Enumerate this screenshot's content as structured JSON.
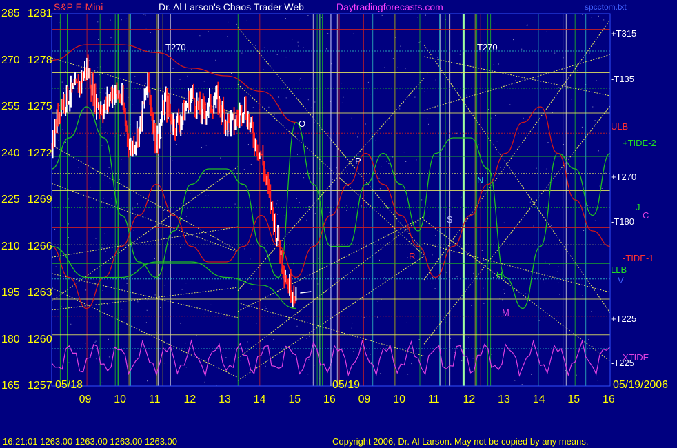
{
  "header": {
    "instrument": "S&P E-Mini",
    "title": "Dr. Al Larson's Chaos Trader Web",
    "site": "Daytradingforecasts.com",
    "filename": "spcctom.txt"
  },
  "footer": {
    "status": "16:21:01  1263.00 1263.00 1263.00 1263.00",
    "copyright": "Copyright 2006, Dr. Al Larson. May not be copied by any means."
  },
  "date_labels": {
    "day1": "05/18",
    "day2": "05/19",
    "right": "05/19/2006"
  },
  "colors": {
    "background": "#000080",
    "price": "#ffffff",
    "down_bars": "#ff2020",
    "tide": "#20c020",
    "ulb_llb": "#d01818",
    "xtide": "#e040e0",
    "levels": "#e8e860",
    "axis_text": "#ffff00"
  },
  "chart_data": {
    "type": "line",
    "title": "S&P E-Mini",
    "xlabel": "",
    "ylabel": "",
    "ylim": [
      1257,
      1281
    ],
    "y_ticks": [
      {
        "left": "285",
        "right": "1281",
        "value": 1281
      },
      {
        "left": "270",
        "right": "1278",
        "value": 1278
      },
      {
        "left": "255",
        "right": "1275",
        "value": 1275
      },
      {
        "left": "240",
        "right": "1272",
        "value": 1272
      },
      {
        "left": "225",
        "right": "1269",
        "value": 1269
      },
      {
        "left": "210",
        "right": "1266",
        "value": 1266
      },
      {
        "left": "195",
        "right": "1263",
        "value": 1263
      },
      {
        "left": "180",
        "right": "1260",
        "value": 1260
      },
      {
        "left": "165",
        "right": "1257",
        "value": 1257
      }
    ],
    "x_ticks": [
      "09",
      "10",
      "11",
      "12",
      "13",
      "14",
      "15",
      "16",
      "09",
      "10",
      "11",
      "12",
      "13",
      "14",
      "15",
      "16"
    ],
    "right_labels": [
      "+T315",
      "-T135",
      "ULB",
      "+TIDE-2",
      "+T270",
      "-T180",
      "-TIDE-1",
      "LLB",
      "+T225",
      "XTIDE",
      "-T225"
    ],
    "flux_markers": [
      "T270",
      "T270",
      "O",
      "P",
      "N",
      "S",
      "H",
      "M",
      "R",
      "J",
      "C",
      "V"
    ],
    "series": [
      {
        "name": "price",
        "x": [
          0,
          0.25,
          0.5,
          0.75,
          1,
          1.25,
          1.5,
          1.75,
          2,
          2.25,
          2.5,
          2.75,
          3,
          3.25,
          3.5,
          3.75,
          4,
          4.25,
          4.5,
          4.75,
          5,
          5.25,
          5.5,
          5.75,
          6,
          6.25,
          6.5,
          6.75,
          7
        ],
        "values": [
          1272.5,
          1275.2,
          1275.8,
          1276.2,
          1277.6,
          1275.4,
          1274.8,
          1276.1,
          1275.5,
          1272.2,
          1273.5,
          1276.5,
          1272.5,
          1275.4,
          1273.8,
          1274.4,
          1275.9,
          1274.6,
          1275.1,
          1275.4,
          1274.1,
          1273.9,
          1275.2,
          1273.2,
          1271.9,
          1269.0,
          1266.3,
          1263.6,
          1263.0
        ]
      },
      {
        "name": "+TIDE-2",
        "x": [
          0,
          0.5,
          1,
          1.5,
          2,
          2.5,
          3,
          3.5,
          4,
          4.5,
          5,
          5.5,
          6,
          6.5,
          7,
          7.5,
          8,
          8.5,
          9,
          9.5,
          10,
          10.5,
          11,
          11.5,
          12,
          12.5,
          13,
          13.5,
          14,
          14.5,
          15,
          15.5,
          16
        ],
        "values": [
          1271,
          1273,
          1275,
          1273,
          1268,
          1265,
          1264,
          1267,
          1270,
          1271,
          1271,
          1270,
          1266,
          1264,
          1274,
          1270,
          1266,
          1266,
          1270,
          1272,
          1270,
          1267,
          1272,
          1273,
          1273,
          1271,
          1264,
          1262,
          1266,
          1272,
          1271,
          1268,
          1272
        ]
      },
      {
        "name": "-TIDE-1",
        "x": [
          0,
          0.5,
          1,
          1.5,
          2,
          2.5,
          3,
          3.5,
          4,
          4.5,
          5,
          5.5,
          6,
          6.5,
          7,
          7.5,
          8,
          8.5,
          9,
          9.5,
          10,
          10.5,
          11,
          11.5,
          12,
          12.5,
          13,
          13.5,
          14,
          14.5,
          15,
          15.5,
          16
        ],
        "values": [
          1266,
          1264,
          1262,
          1264,
          1266,
          1268,
          1270,
          1268,
          1266,
          1265,
          1265,
          1266,
          1268,
          1266,
          1264,
          1266,
          1268,
          1270,
          1272,
          1270,
          1268,
          1266,
          1264,
          1266,
          1268,
          1270,
          1272,
          1274,
          1275,
          1272,
          1269,
          1267,
          1266
        ]
      },
      {
        "name": "ULB",
        "x": [
          0,
          1,
          2,
          3,
          4,
          5,
          6,
          7
        ],
        "values": [
          1278,
          1279,
          1279,
          1278.5,
          1277.5,
          1277,
          1276,
          1274
        ]
      },
      {
        "name": "LLB",
        "x": [
          0,
          1,
          2,
          3,
          4,
          5,
          6,
          7
        ],
        "values": [
          1266,
          1264,
          1264,
          1265,
          1265,
          1264,
          1263.5,
          1262
        ]
      }
    ]
  }
}
